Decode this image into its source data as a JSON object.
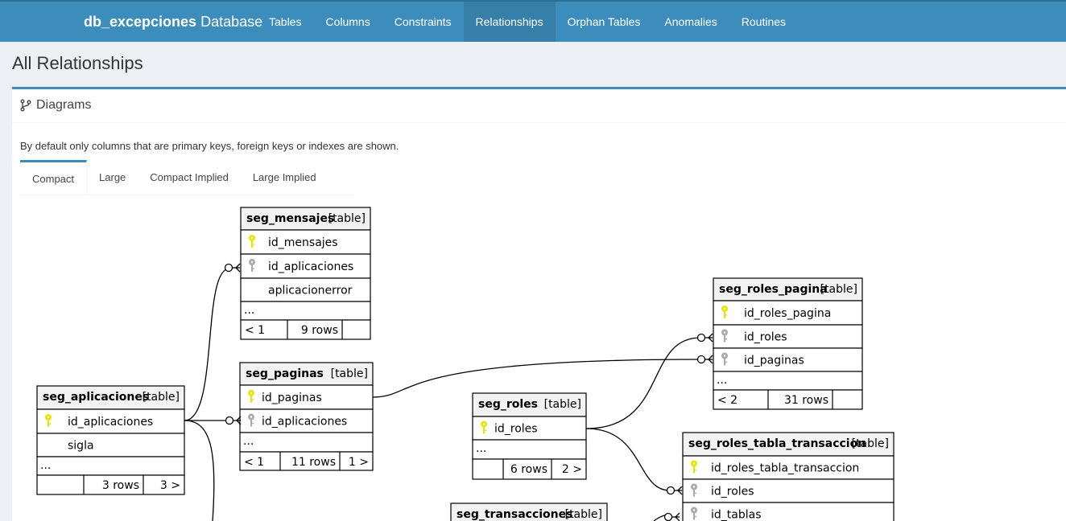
{
  "header": {
    "db_name": "db_excepciones",
    "db_suffix": "Database",
    "nav": [
      "Tables",
      "Columns",
      "Constraints",
      "Relationships",
      "Orphan Tables",
      "Anomalies",
      "Routines"
    ],
    "active_nav": "Relationships"
  },
  "page": {
    "title": "All Relationships",
    "box_title": "Diagrams",
    "description": "By default only columns that are primary keys, foreign keys or indexes are shown.",
    "tabs": [
      "Compact",
      "Large",
      "Compact Implied",
      "Large Implied"
    ],
    "active_tab": "Compact"
  },
  "colors": {
    "header": "#3c8dbc",
    "key_primary": "#e5e500",
    "key_foreign": "#aaaaaa"
  },
  "diagram": {
    "tables": {
      "seg_mensajes": {
        "name": "seg_mensajes",
        "tag": "[table]",
        "columns": [
          {
            "name": "id_mensajes",
            "key": "primary"
          },
          {
            "name": "id_aplicaciones",
            "key": "foreign"
          },
          {
            "name": "aplicacionerror",
            "key": ""
          }
        ],
        "more": "...",
        "footer": [
          "< 1",
          "9 rows",
          ""
        ]
      },
      "seg_paginas": {
        "name": "seg_paginas",
        "tag": "[table]",
        "columns": [
          {
            "name": "id_paginas",
            "key": "primary"
          },
          {
            "name": "id_aplicaciones",
            "key": "foreign"
          }
        ],
        "more": "...",
        "footer": [
          "< 1",
          "11 rows",
          "1 >"
        ]
      },
      "seg_aplicaciones": {
        "name": "seg_aplicaciones",
        "tag": "[table]",
        "columns": [
          {
            "name": "id_aplicaciones",
            "key": "primary"
          },
          {
            "name": "sigla",
            "key": ""
          }
        ],
        "more": "...",
        "footer": [
          "",
          "3 rows",
          "3 >"
        ]
      },
      "seg_roles": {
        "name": "seg_roles",
        "tag": "[table]",
        "columns": [
          {
            "name": "id_roles",
            "key": "primary"
          }
        ],
        "more": "...",
        "footer": [
          "",
          "6 rows",
          "2 >"
        ]
      },
      "seg_roles_pagina": {
        "name": "seg_roles_pagina",
        "tag": "[table]",
        "columns": [
          {
            "name": "id_roles_pagina",
            "key": "primary"
          },
          {
            "name": "id_roles",
            "key": "foreign"
          },
          {
            "name": "id_paginas",
            "key": "foreign"
          }
        ],
        "more": "...",
        "footer": [
          "< 2",
          "31 rows",
          ""
        ]
      },
      "seg_roles_tabla_transaccion": {
        "name": "seg_roles_tabla_transaccion",
        "tag": "[table]",
        "columns": [
          {
            "name": "id_roles_tabla_transaccion",
            "key": "primary"
          },
          {
            "name": "id_roles",
            "key": "foreign"
          },
          {
            "name": "id_tablas",
            "key": "foreign"
          }
        ]
      },
      "seg_transacciones": {
        "name": "seg_transacciones",
        "tag": "[table]",
        "columns": []
      }
    }
  }
}
